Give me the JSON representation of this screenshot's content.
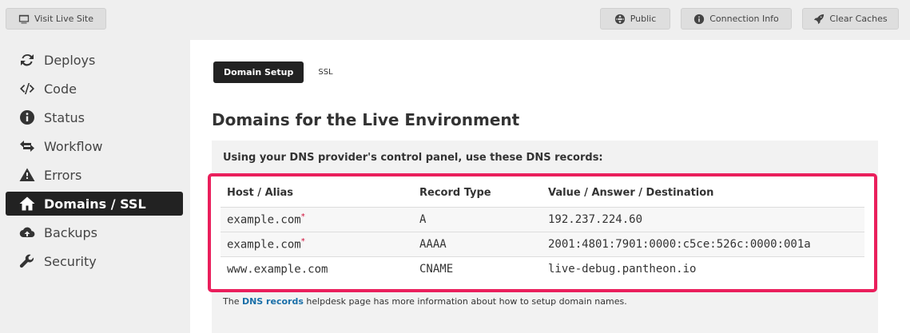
{
  "topbar": {
    "visit_label": "Visit Live Site",
    "public_label": "Public",
    "connection_label": "Connection Info",
    "clear_caches_label": "Clear Caches"
  },
  "sidebar": {
    "items": [
      {
        "label": "Deploys",
        "icon": "refresh-icon"
      },
      {
        "label": "Code",
        "icon": "code-icon"
      },
      {
        "label": "Status",
        "icon": "info-icon"
      },
      {
        "label": "Workflow",
        "icon": "arrows-icon"
      },
      {
        "label": "Errors",
        "icon": "warning-icon"
      },
      {
        "label": "Domains / SSL",
        "icon": "home-icon",
        "active": true
      },
      {
        "label": "Backups",
        "icon": "cloud-upload-icon"
      },
      {
        "label": "Security",
        "icon": "wrench-icon"
      }
    ]
  },
  "tabs": {
    "domain_setup": "Domain Setup",
    "ssl": "SSL"
  },
  "page_title": "Domains for the Live Environment",
  "dns": {
    "intro": "Using your DNS provider's control panel, use these DNS records:",
    "headers": {
      "host": "Host / Alias",
      "type": "Record Type",
      "value": "Value / Answer / Destination"
    },
    "rows": [
      {
        "host": "example.com",
        "required": "*",
        "type": "A",
        "value": "192.237.224.60"
      },
      {
        "host": "example.com",
        "required": "*",
        "type": "AAAA",
        "value": "2001:4801:7901:0000:c5ce:526c:0000:001a"
      },
      {
        "host": "www.example.com",
        "required": "",
        "type": "CNAME",
        "value": "live-debug.pantheon.io"
      }
    ],
    "note_prefix": "The",
    "note_link": "DNS records",
    "note_suffix": "helpdesk page has more information about how to setup domain names."
  },
  "colors": {
    "highlight": "#ea1f5c",
    "link": "#1a6fa8",
    "active_bg": "#222222"
  }
}
